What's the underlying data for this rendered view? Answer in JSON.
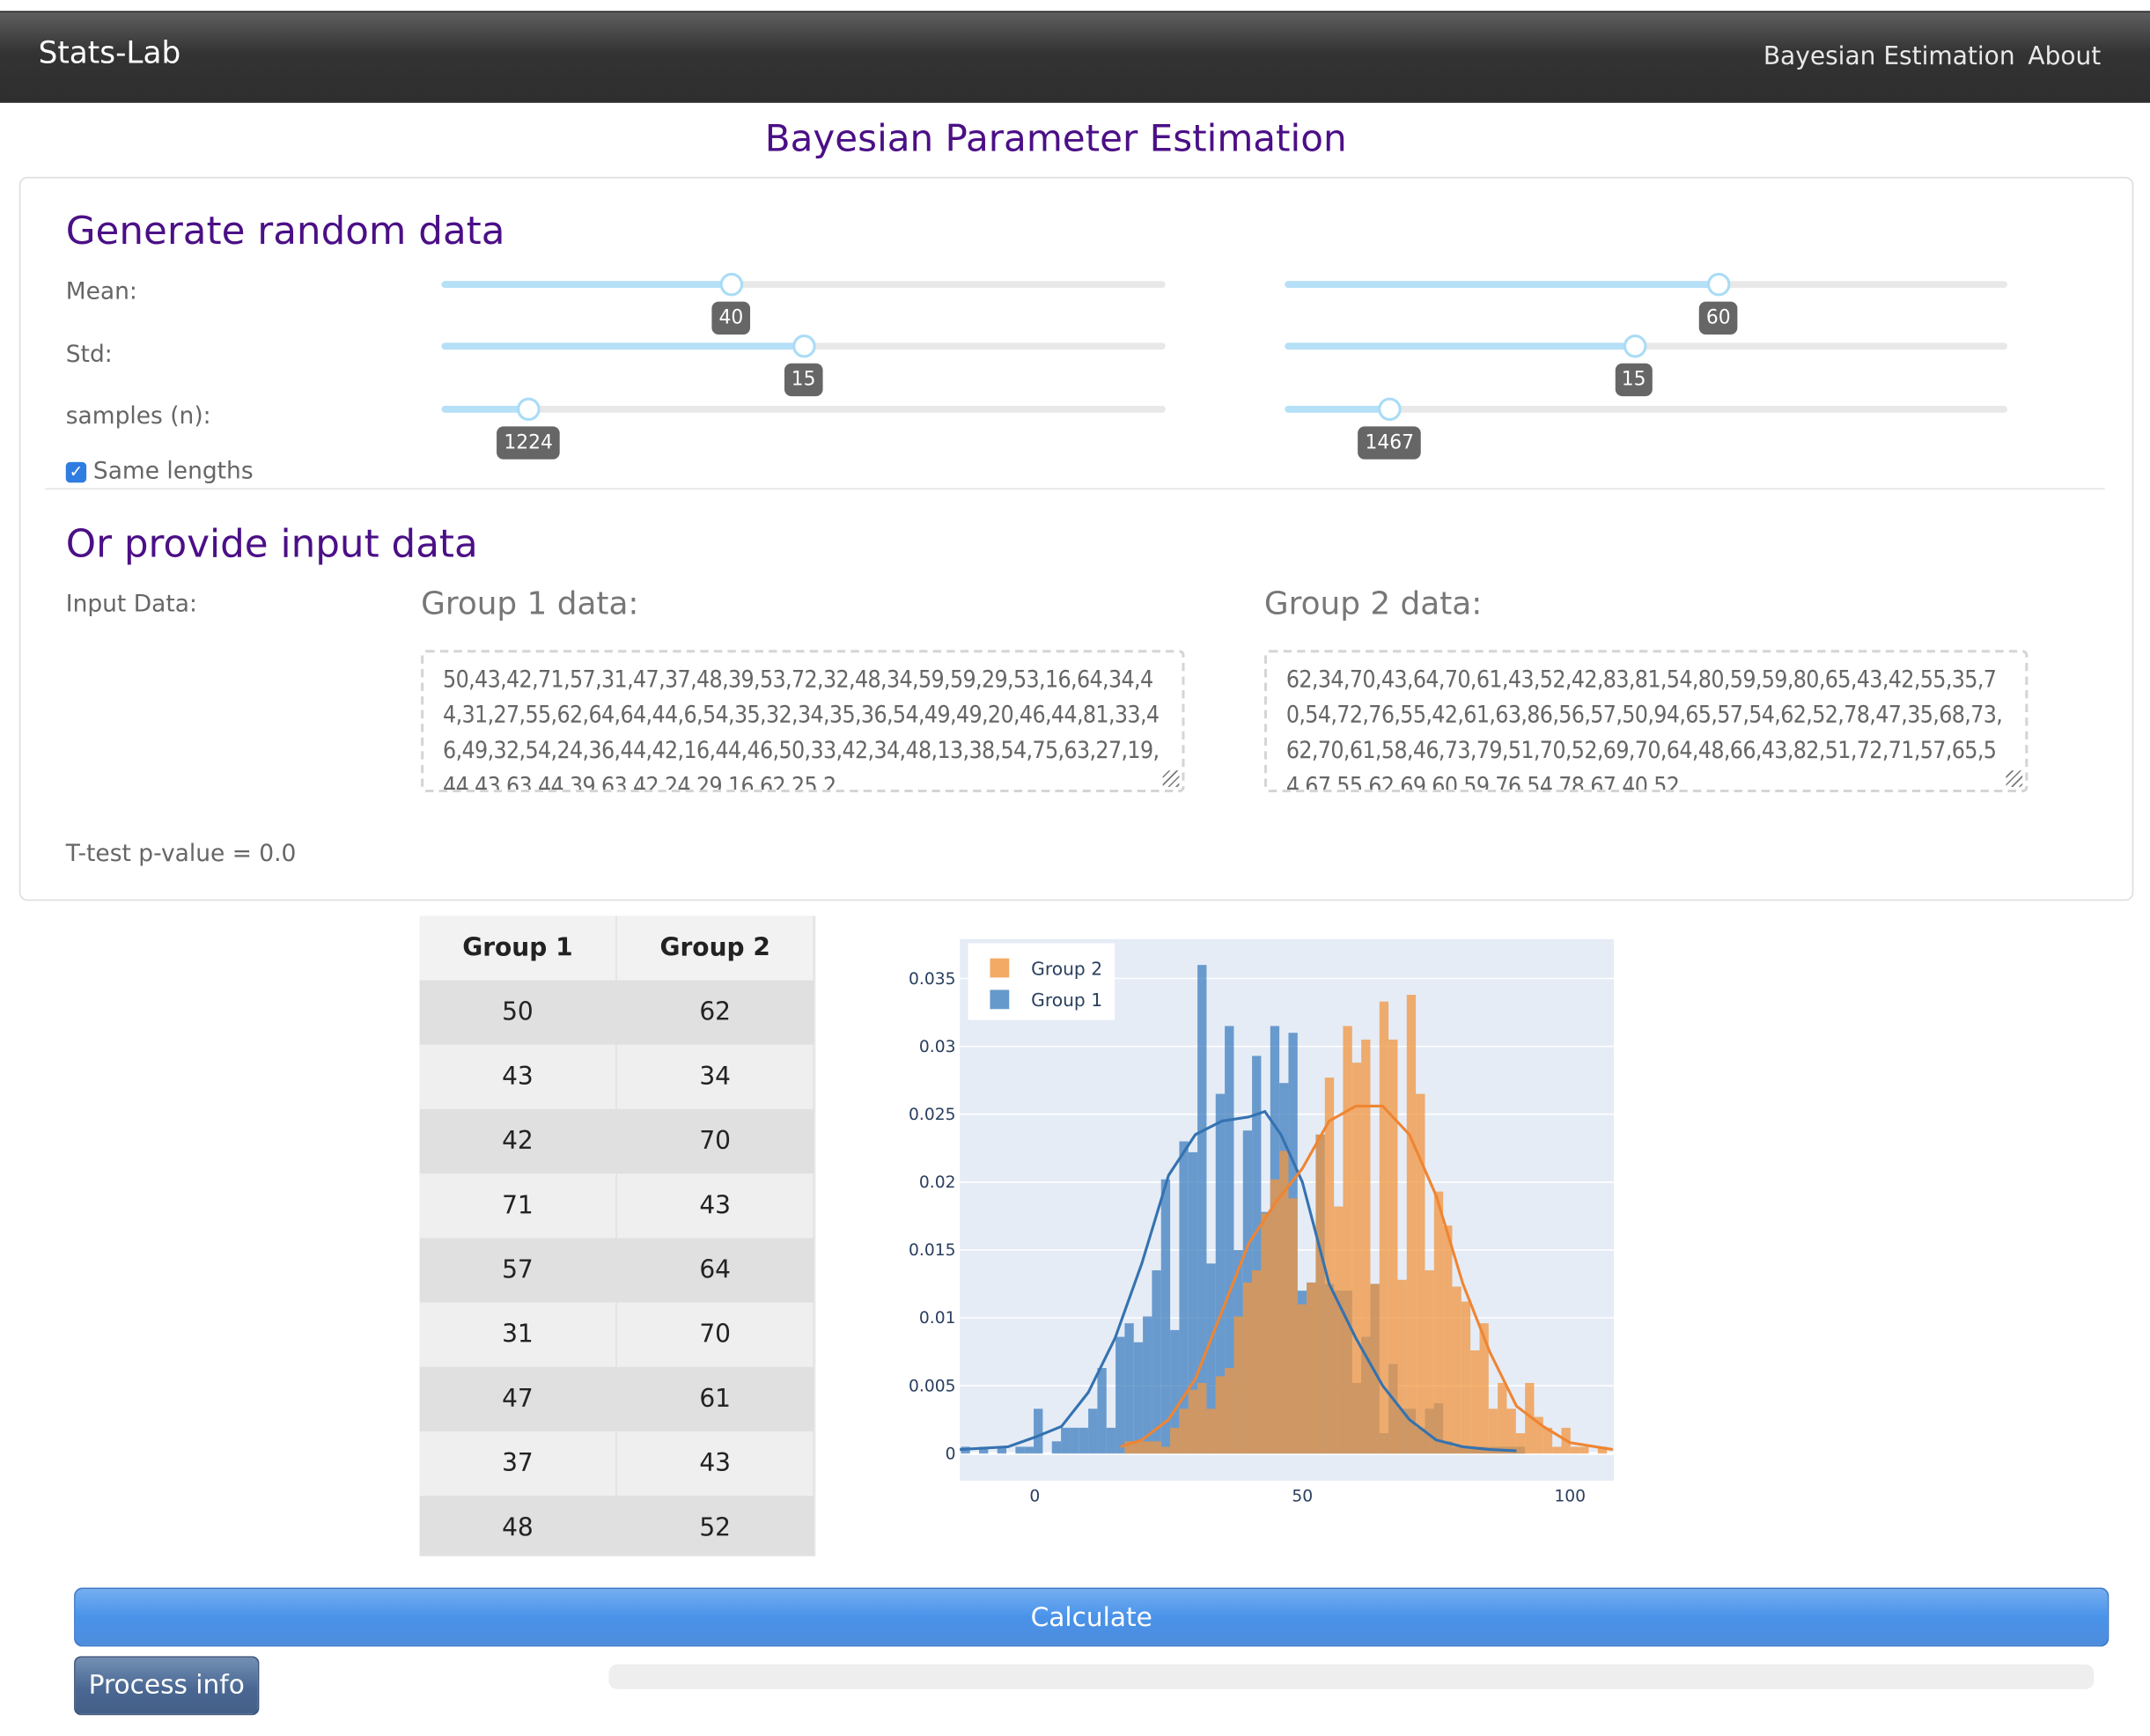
{
  "navbar": {
    "brand": "Stats-Lab",
    "links": [
      "Bayesian Estimation",
      "About"
    ]
  },
  "page_title": "Bayesian Parameter Estimation",
  "generate": {
    "title": "Generate random data",
    "labels": {
      "mean": "Mean:",
      "std": "Std:",
      "samples": "samples (n):"
    },
    "group1": {
      "mean": {
        "value": "40",
        "fraction": 0.4
      },
      "std": {
        "value": "15",
        "fraction": 0.5
      },
      "samples": {
        "value": "1224",
        "fraction": 0.12
      }
    },
    "group2": {
      "mean": {
        "value": "60",
        "fraction": 0.6
      },
      "std": {
        "value": "15",
        "fraction": 0.483
      },
      "samples": {
        "value": "1467",
        "fraction": 0.145
      }
    },
    "same_lengths": {
      "label": "Same lengths",
      "checked": true
    }
  },
  "input": {
    "title": "Or provide input data",
    "label": "Input Data:",
    "group1_title": "Group 1 data:",
    "group2_title": "Group 2 data:",
    "group1_value": "50,43,42,71,57,31,47,37,48,39,53,72,32,48,34,59,59,29,53,16,64,34,44,31,27,55,62,64,64,44,6,54,35,32,34,35,36,54,49,49,20,46,44,81,33,46,49,32,54,24,36,44,42,16,44,46,50,33,42,34,48,13,38,54,75,63,27,19,44,43,63,44,39,63,42,24,29,16,62,25,2",
    "group2_value": "62,34,70,43,64,70,61,43,52,42,83,81,54,80,59,59,80,65,43,42,55,35,70,54,72,76,55,42,61,63,86,56,57,50,94,65,57,54,62,52,78,47,35,68,73,62,70,61,58,46,73,79,51,70,52,69,70,64,48,66,43,82,51,72,71,57,65,54,67,55,62,69,60,59,76,54,78,67,40,52,",
    "ttest": "T-test p-value = 0.0"
  },
  "table": {
    "headers": [
      "Group 1",
      "Group 2"
    ],
    "rows": [
      [
        "50",
        "62"
      ],
      [
        "43",
        "34"
      ],
      [
        "42",
        "70"
      ],
      [
        "71",
        "43"
      ],
      [
        "57",
        "64"
      ],
      [
        "31",
        "70"
      ],
      [
        "47",
        "61"
      ],
      [
        "37",
        "43"
      ],
      [
        "48",
        "52"
      ]
    ]
  },
  "chart_data": {
    "type": "bar",
    "subtype": "overlaid histogram with density curves",
    "bin_start": -13.8,
    "bin_width": 1.7,
    "xlim": [
      -14,
      108.2
    ],
    "ylim": [
      -0.002,
      0.0379
    ],
    "x_ticks": [
      "0",
      "50",
      "100"
    ],
    "x_tick_values": [
      0,
      50,
      100
    ],
    "y_ticks": [
      "0",
      "0.005",
      "0.01",
      "0.015",
      "0.02",
      "0.025",
      "0.03",
      "0.035"
    ],
    "y_tick_values": [
      0,
      0.005,
      0.01,
      0.015,
      0.02,
      0.025,
      0.03,
      0.035
    ],
    "grid": true,
    "legend": {
      "placement": "top-left",
      "entries": [
        "Group 2",
        "Group 1"
      ]
    },
    "series": [
      {
        "name": "Group 1",
        "color": "#3f7fbf",
        "values": [
          0.0005,
          0,
          0.0005,
          0,
          0.0005,
          0,
          0.0005,
          0.0005,
          0.0033,
          0,
          0.0009,
          0.0019,
          0.0019,
          0.0019,
          0.0033,
          0.0063,
          0.0019,
          0.0086,
          0.0096,
          0.0082,
          0.0101,
          0.0135,
          0.0202,
          0.0091,
          0.023,
          0.0222,
          0.036,
          0.014,
          0.0265,
          0.0315,
          0.015,
          0.0238,
          0.0293,
          0.0178,
          0.0315,
          0.0273,
          0.031,
          0.012,
          0.0126,
          0.0235,
          0.0125,
          0.012,
          0.012,
          0.0052,
          0.0086,
          0.0125,
          0.0015,
          0.0066,
          0.0033,
          0.0033,
          0.0019,
          0.0033,
          0.0037,
          0.0009,
          0.0005,
          0.0005,
          0.0005,
          0.0005,
          0.0005,
          0.0005,
          0.0005,
          0.0005
        ],
        "kde": [
          [
            -14,
            0.0003
          ],
          [
            -5,
            0.0005
          ],
          [
            0,
            0.0012
          ],
          [
            5,
            0.002
          ],
          [
            10,
            0.0045
          ],
          [
            15,
            0.0085
          ],
          [
            20,
            0.014
          ],
          [
            25,
            0.0205
          ],
          [
            30,
            0.0235
          ],
          [
            35,
            0.0245
          ],
          [
            40,
            0.0248
          ],
          [
            43,
            0.0252
          ],
          [
            46,
            0.0235
          ],
          [
            50,
            0.02
          ],
          [
            55,
            0.0125
          ],
          [
            60,
            0.0085
          ],
          [
            65,
            0.005
          ],
          [
            70,
            0.0025
          ],
          [
            75,
            0.001
          ],
          [
            80,
            0.0005
          ],
          [
            85,
            0.0003
          ],
          [
            90,
            0.0002
          ]
        ]
      },
      {
        "name": "Group 2",
        "color": "#f0953f",
        "values": [
          0,
          0,
          0,
          0,
          0,
          0,
          0,
          0,
          0,
          0,
          0,
          0,
          0,
          0,
          0,
          0,
          0,
          0,
          0.0009,
          0.0009,
          0.0009,
          0.0009,
          0.0005,
          0.0019,
          0.0033,
          0.0047,
          0.0052,
          0.0033,
          0.0057,
          0.0063,
          0.0101,
          0.0126,
          0.0135,
          0.0177,
          0.0202,
          0.0223,
          0.0188,
          0.011,
          0.0126,
          0.0235,
          0.0277,
          0.0182,
          0.0315,
          0.0288,
          0.0305,
          0.0125,
          0.0333,
          0.0305,
          0.0128,
          0.0338,
          0.0265,
          0.0135,
          0.0193,
          0.0168,
          0.0123,
          0.0112,
          0.0076,
          0.0096,
          0.0033,
          0.0052,
          0.0033,
          0.0015,
          0.0052,
          0.0027,
          0.0019,
          0.0005,
          0.0019,
          0.0005,
          0.0005,
          0,
          0.0005
        ],
        "kde": [
          [
            16,
            0.0005
          ],
          [
            20,
            0.001
          ],
          [
            25,
            0.0025
          ],
          [
            30,
            0.0055
          ],
          [
            35,
            0.0105
          ],
          [
            40,
            0.0155
          ],
          [
            45,
            0.0185
          ],
          [
            50,
            0.021
          ],
          [
            55,
            0.0245
          ],
          [
            60,
            0.0256
          ],
          [
            65,
            0.0256
          ],
          [
            70,
            0.0235
          ],
          [
            75,
            0.019
          ],
          [
            80,
            0.0125
          ],
          [
            85,
            0.0075
          ],
          [
            90,
            0.0035
          ],
          [
            95,
            0.002
          ],
          [
            100,
            0.0008
          ],
          [
            108,
            0.0003
          ]
        ]
      }
    ]
  },
  "buttons": {
    "calculate": "Calculate",
    "process_info": "Process info"
  },
  "progress": {
    "fraction": 0
  }
}
